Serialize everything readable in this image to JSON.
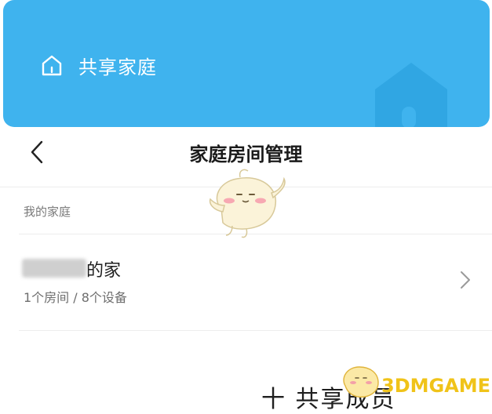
{
  "banner": {
    "title": "共享家庭",
    "icon": "home-icon",
    "background_color": "#3fb3ee"
  },
  "header": {
    "back_icon": "chevron-left-icon",
    "title": "家庭房间管理"
  },
  "section": {
    "label": "我的家庭"
  },
  "family": {
    "name_suffix": "的家",
    "meta": "1个房间 / 8个设备",
    "chevron_icon": "chevron-right-icon"
  },
  "share": {
    "label": "十 共享成员"
  },
  "watermark": {
    "text": "3DMGAME",
    "color": "#f0c319"
  }
}
